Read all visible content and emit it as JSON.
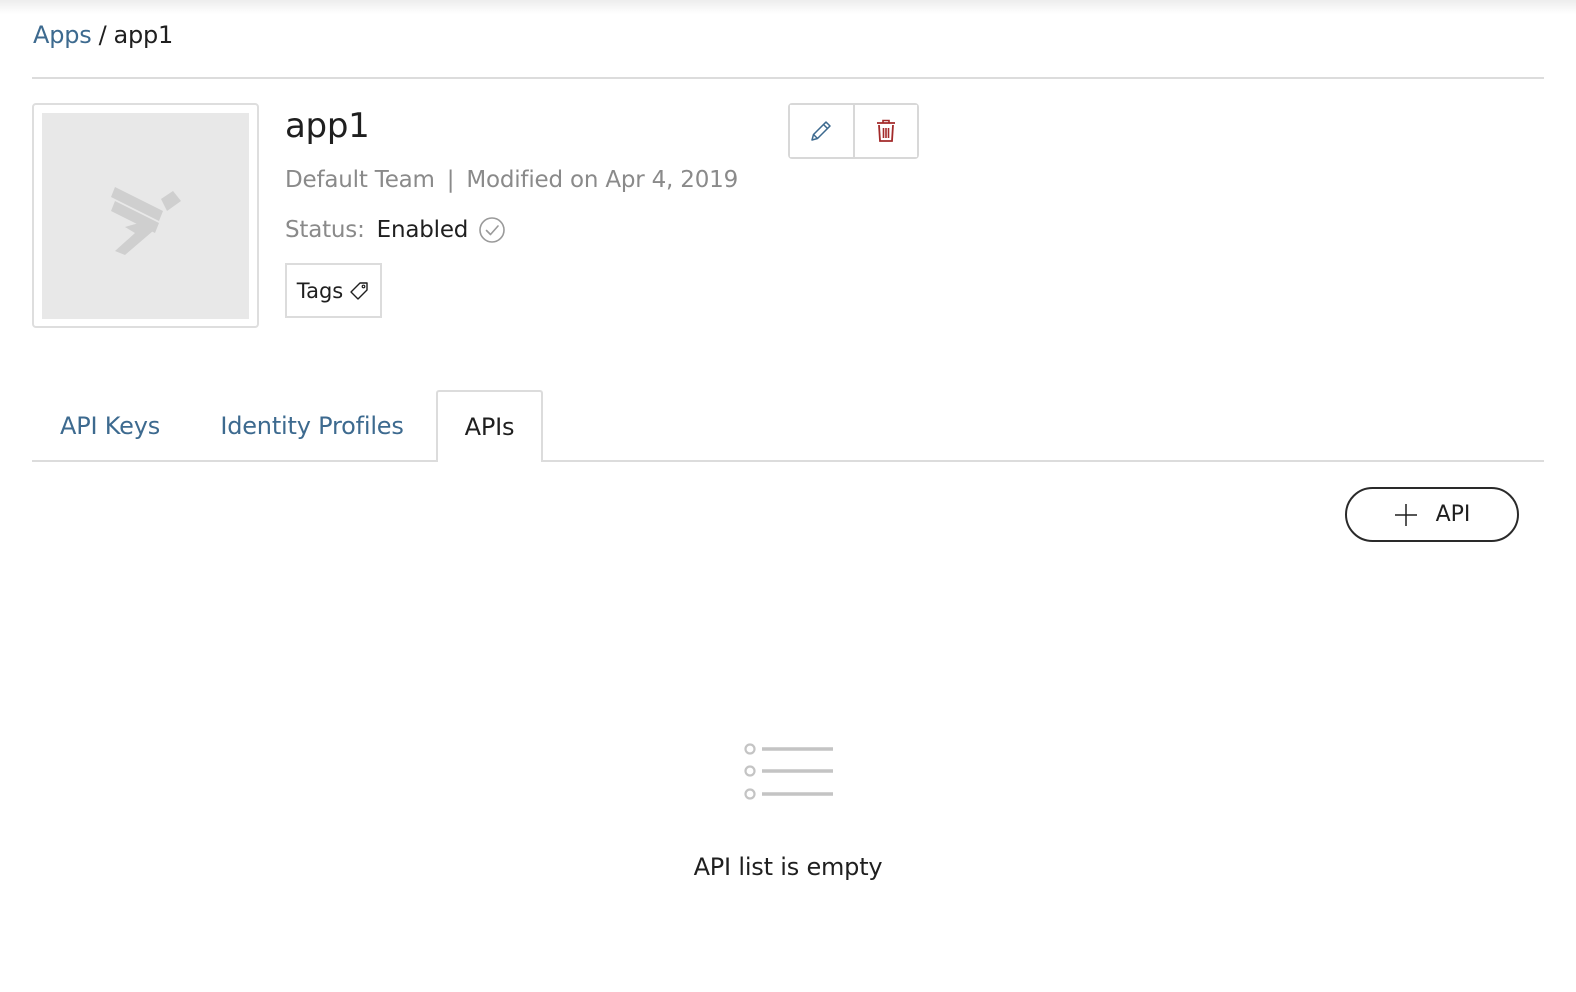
{
  "breadcrumb": {
    "parent": "Apps",
    "separator": "/",
    "current": "app1"
  },
  "app": {
    "name": "app1",
    "team": "Default Team",
    "separator": "|",
    "modified": "Modified on Apr 4, 2019",
    "status_label": "Status:",
    "status_value": "Enabled",
    "tags_label": "Tags"
  },
  "actions": {
    "edit_icon": "pencil-icon",
    "delete_icon": "trash-icon"
  },
  "tabs": [
    {
      "label": "API Keys",
      "active": false
    },
    {
      "label": "Identity Profiles",
      "active": false
    },
    {
      "label": "APIs",
      "active": true
    }
  ],
  "apis": {
    "add_button_label": "API",
    "empty_message": "API list is empty"
  },
  "colors": {
    "link": "#3d6a8f",
    "delete": "#a32a2a",
    "border": "#dcdcdc"
  }
}
